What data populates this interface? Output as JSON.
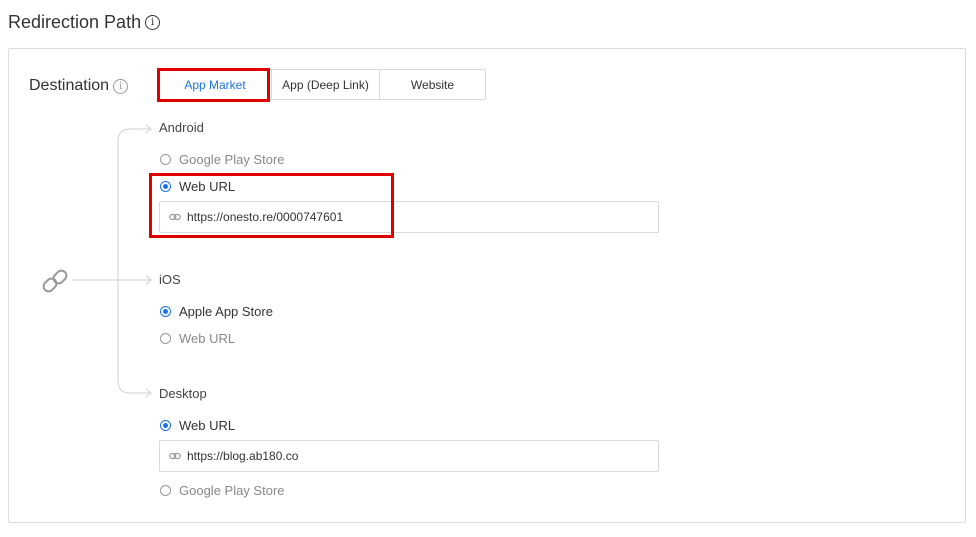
{
  "header": {
    "title": "Redirection Path",
    "info_icon": "info-icon"
  },
  "destination": {
    "label": "Destination",
    "tabs": [
      {
        "label": "App Market",
        "selected": true
      },
      {
        "label": "App (Deep Link)",
        "selected": false
      },
      {
        "label": "Website",
        "selected": false
      }
    ]
  },
  "android": {
    "label": "Android",
    "options": [
      {
        "label": "Google Play Store",
        "selected": false
      },
      {
        "label": "Web URL",
        "selected": true
      }
    ],
    "url_value": "https://onesto.re/0000747601"
  },
  "ios": {
    "label": "iOS",
    "options": [
      {
        "label": "Apple App Store",
        "selected": true
      },
      {
        "label": "Web URL",
        "selected": false
      }
    ]
  },
  "desktop": {
    "label": "Desktop",
    "options": [
      {
        "label": "Web URL",
        "selected": true
      },
      {
        "label": "Google Play Store",
        "selected": false
      }
    ],
    "url_value": "https://blog.ab180.co"
  },
  "colors": {
    "accent": "#1a73e8",
    "highlight": "#e00000",
    "border": "#dcdcdc"
  }
}
